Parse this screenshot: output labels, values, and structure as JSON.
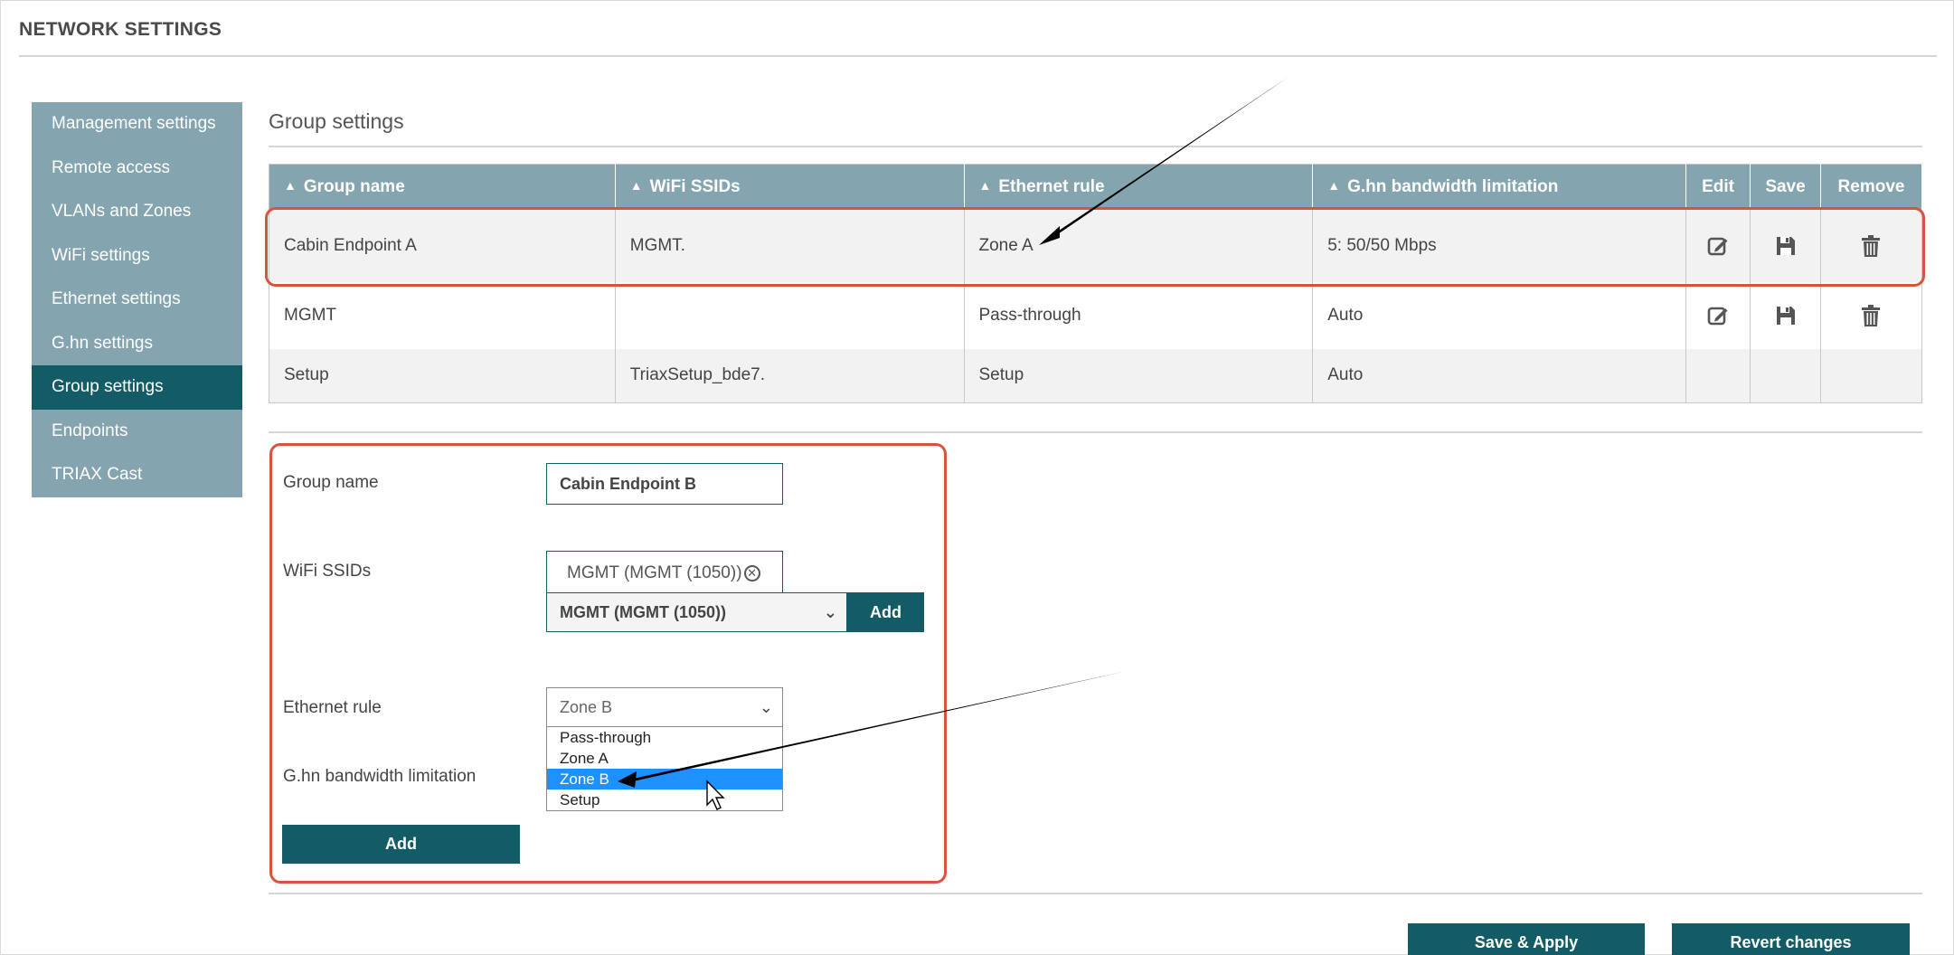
{
  "page": {
    "title": "NETWORK SETTINGS"
  },
  "sidebar": {
    "items": [
      {
        "label": "Management settings"
      },
      {
        "label": "Remote access"
      },
      {
        "label": "VLANs and Zones"
      },
      {
        "label": "WiFi settings"
      },
      {
        "label": "Ethernet settings"
      },
      {
        "label": "G.hn settings"
      },
      {
        "label": "Group settings",
        "active": true
      },
      {
        "label": "Endpoints"
      },
      {
        "label": "TRIAX Cast"
      }
    ]
  },
  "section": {
    "title": "Group settings"
  },
  "table": {
    "headers": {
      "group_name": "Group name",
      "wifi_ssids": "WiFi SSIDs",
      "ethernet_rule": "Ethernet rule",
      "ghn_bandwidth": "G.hn bandwidth limitation",
      "edit": "Edit",
      "save": "Save",
      "remove": "Remove"
    },
    "rows": [
      {
        "group_name": "Cabin Endpoint A",
        "wifi_ssids": "MGMT.",
        "ethernet_rule": "Zone A",
        "ghn_bandwidth": "5: 50/50 Mbps",
        "actions": [
          "edit-icon",
          "save-icon",
          "trash-icon"
        ]
      },
      {
        "group_name": "MGMT",
        "wifi_ssids": "",
        "ethernet_rule": "Pass-through",
        "ghn_bandwidth": "Auto",
        "actions": [
          "edit-icon",
          "save-icon",
          "trash-icon"
        ]
      },
      {
        "group_name": "Setup",
        "wifi_ssids": "TriaxSetup_bde7.",
        "ethernet_rule": "Setup",
        "ghn_bandwidth": "Auto",
        "actions": []
      }
    ]
  },
  "form": {
    "group_name_label": "Group name",
    "group_name_value": "Cabin Endpoint B",
    "wifi_ssids_label": "WiFi SSIDs",
    "selected_ssid_chip": "MGMT (MGMT (1050))",
    "ssid_select_value": "MGMT (MGMT (1050))",
    "ssid_add_label": "Add",
    "ethernet_rule_label": "Ethernet rule",
    "ethernet_rule_value": "Zone B",
    "ethernet_rule_options": [
      "Pass-through",
      "Zone A",
      "Zone B",
      "Setup"
    ],
    "ethernet_rule_highlighted": "Zone B",
    "ghn_bandwidth_label": "G.hn bandwidth limitation",
    "add_label": "Add"
  },
  "footer": {
    "save_apply_label": "Save & Apply",
    "revert_label": "Revert changes"
  },
  "colors": {
    "sidebar_bg": "#84a5af",
    "accent_dark": "#135c66",
    "highlight_red": "#d9533e",
    "dropdown_selected": "#1e90ff"
  }
}
